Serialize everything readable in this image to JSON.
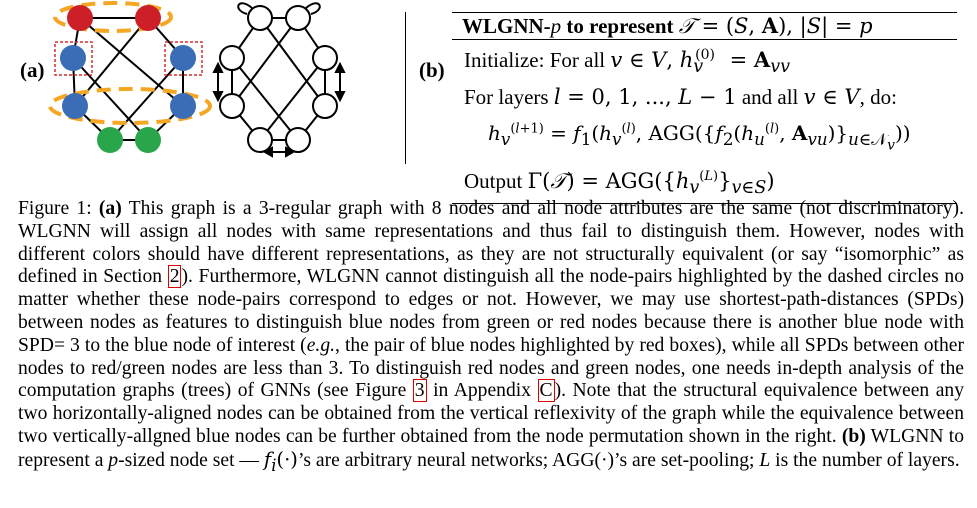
{
  "figure": {
    "panel_a_label": "(a)",
    "panel_b_label": "(b)",
    "colors": {
      "red_node": "#cc1f28",
      "blue_node": "#3a6db5",
      "green_node": "#2aa64a",
      "highlight_dash": "#f5a623",
      "box_dash": "#d32f2f"
    },
    "algorithm": {
      "title_bold": "WLGNN-",
      "title_p": "p",
      "title_rest": " to represent ",
      "init_prefix": "Initialize: For all ",
      "layers_prefix": "For layers ",
      "layers_mid": " and all ",
      "layers_do": ", do:",
      "output_prefix": "Output "
    }
  },
  "caption": {
    "label": "Figure 1:",
    "part_a_tag": "(a)",
    "text_1": " This graph is a 3-regular graph with 8 nodes and all node attributes are the same (not discriminatory). WLGNN will assign all nodes with same representations and thus fail to distinguish them. However, nodes with different colors should have different representations, as they are not structurally equivalent (or say “isomorphic” as defined in Section ",
    "ref_section": "2",
    "text_2": "). Furthermore, WLGNN cannot distinguish all the node-pairs highlighted by the dashed circles no matter whether these node-pairs correspond to edges or not. However, we may use shortest-path-distances (SPDs) between nodes as features to distinguish blue nodes from green or red nodes because there is another blue node with SPD= 3 to the blue node of interest (",
    "eg": "e.g.",
    "text_3": ", the pair of blue nodes highlighted by red boxes), while all SPDs between other nodes to red/green nodes are less than 3. To distinguish red nodes and green nodes, one needs in-depth analysis of the computation graphs (trees) of GNNs (see Figure ",
    "ref_figure": "3",
    "text_4": " in Appendix ",
    "ref_appendix": "C",
    "text_5": "). Note that the structural equivalence between any two horizontally-aligned nodes can be obtained from the vertical reflexivity of the graph while the equivalence between two vertically-allgned blue nodes can be further obtained from the node permutation shown in the right. ",
    "part_b_tag": "(b)",
    "text_6": " WLGNN to represent a ",
    "text_6_p": "p",
    "text_7": "-sized node set — ",
    "text_8": "’s are arbitrary neural networks; AGG(·)’s are set-pooling; ",
    "text_8_L": "L",
    "text_9": " is the number of layers."
  }
}
